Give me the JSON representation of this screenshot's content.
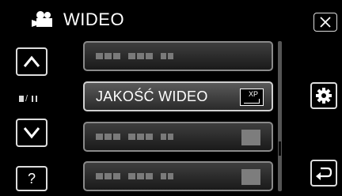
{
  "header": {
    "title": "WIDEO",
    "mode_icon": "video-camera-icon"
  },
  "buttons": {
    "close": "close-icon",
    "up": "chevron-up-icon",
    "down": "chevron-down-icon",
    "help_label": "?",
    "settings": "gear-icon",
    "back": "return-icon"
  },
  "mode_indicator": "playback-mode-icon",
  "menu": {
    "items": [
      {
        "label": "",
        "state": "disabled"
      },
      {
        "label": "JAKOŚĆ WIDEO",
        "value_badge": "XP",
        "state": "selected"
      },
      {
        "label": "",
        "state": "disabled"
      },
      {
        "label": "",
        "state": "disabled"
      }
    ]
  },
  "scrollbar": {
    "position": 0.68
  },
  "colors": {
    "background": "#000000",
    "text": "#ffffff",
    "border": "#cfcfcf"
  }
}
